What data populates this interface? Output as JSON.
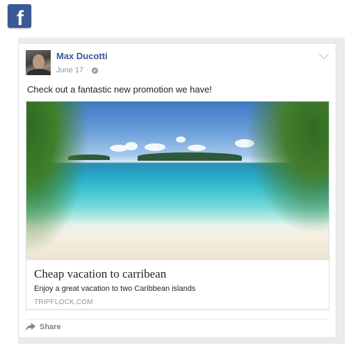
{
  "app": {
    "logo_letter": "f"
  },
  "post": {
    "author": "Max Ducotti",
    "date": "June 17",
    "separator": "·",
    "privacy_icon": "globe-icon",
    "menu_icon": "chevron-down-icon",
    "status_text": "Check out a fantastic new promotion we have!"
  },
  "link": {
    "title": "Cheap vacation to carribean",
    "description": "Enjoy a great vacation to two Caribbean islands",
    "domain": "TRIPFLOCK.COM"
  },
  "actions": {
    "share_label": "Share",
    "share_icon": "share-arrow-icon"
  },
  "colors": {
    "brand": "#3b5998",
    "author_link": "#365899",
    "meta_gray": "#90949c"
  }
}
